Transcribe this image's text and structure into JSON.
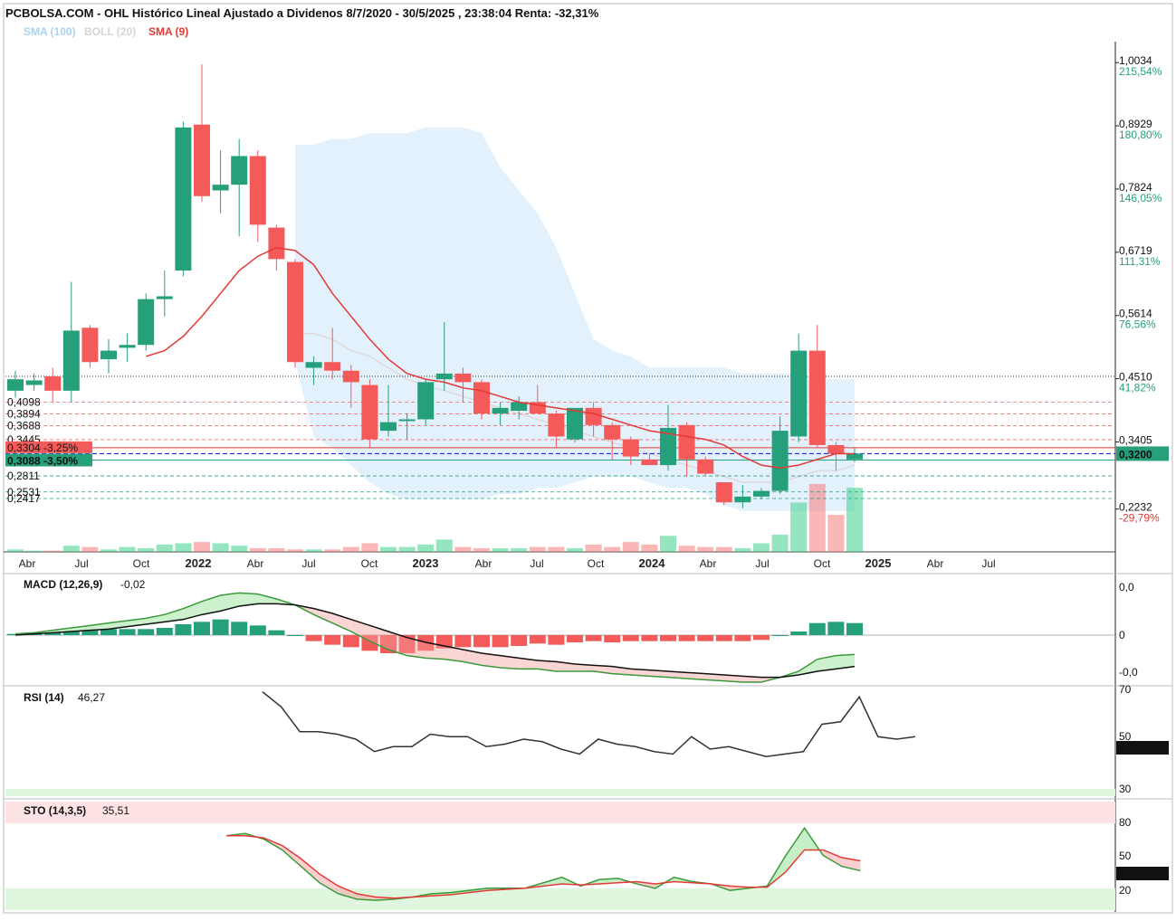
{
  "header": {
    "title": "PCBOLSA.COM - OHL Histórico Lineal Ajustado a Dividenos 8/7/2020 - 30/5/2025 , 23:38:04 Renta: -32,31%",
    "legend": [
      {
        "label": "SMA (100)",
        "color": "#a9d4f0"
      },
      {
        "label": "BOLL (20)",
        "color": "#d4d4d4"
      },
      {
        "label": "SMA (9)",
        "color": "#e53935"
      }
    ]
  },
  "colors": {
    "up": "#26a07a",
    "down": "#f55a5a",
    "sma9": "#e53935",
    "boll_fill": "#cfe8fa",
    "boll_mid": "#e0d8d8"
  },
  "chart_data": [
    {
      "type": "candlestick",
      "name": "price",
      "ylim": [
        0.18,
        1.04
      ],
      "x_labels": [
        "Abr",
        "Jul",
        "Oct",
        "2022",
        "Abr",
        "Jul",
        "Oct",
        "2023",
        "Abr",
        "Jul",
        "Oct",
        "2024",
        "Abr",
        "Jul",
        "Oct",
        "2025",
        "Abr",
        "Jul"
      ],
      "right_axis": [
        {
          "value": "1,0034",
          "pct": "215,54%"
        },
        {
          "value": "0,8929",
          "pct": "180,80%"
        },
        {
          "value": "0,7824",
          "pct": "146,05%"
        },
        {
          "value": "0,6719",
          "pct": "111,31%"
        },
        {
          "value": "0,5614",
          "pct": "76,56%"
        },
        {
          "value": "0,4510",
          "pct": "41,82%"
        },
        {
          "value": "0,3405",
          "pct": "7,08%"
        },
        {
          "value": "0,2232",
          "pct": "-29,79%"
        }
      ],
      "current_price": "0,3200",
      "left_levels": [
        "0,4098",
        "0,3894",
        "0,3688",
        "0,3445",
        "0,3304 -3,25%",
        "0,3088 -3,50%",
        "0,2811",
        "0,2531",
        "0,2417"
      ],
      "candles": [
        {
          "o": 0.43,
          "h": 0.465,
          "l": 0.418,
          "c": 0.45
        },
        {
          "o": 0.44,
          "h": 0.46,
          "l": 0.43,
          "c": 0.448
        },
        {
          "o": 0.455,
          "h": 0.47,
          "l": 0.41,
          "c": 0.43
        },
        {
          "o": 0.43,
          "h": 0.62,
          "l": 0.41,
          "c": 0.535
        },
        {
          "o": 0.54,
          "h": 0.545,
          "l": 0.47,
          "c": 0.48
        },
        {
          "o": 0.485,
          "h": 0.52,
          "l": 0.46,
          "c": 0.5
        },
        {
          "o": 0.505,
          "h": 0.53,
          "l": 0.48,
          "c": 0.51
        },
        {
          "o": 0.51,
          "h": 0.6,
          "l": 0.5,
          "c": 0.59
        },
        {
          "o": 0.59,
          "h": 0.64,
          "l": 0.56,
          "c": 0.595
        },
        {
          "o": 0.64,
          "h": 0.9,
          "l": 0.63,
          "c": 0.89
        },
        {
          "o": 0.895,
          "h": 1.0,
          "l": 0.76,
          "c": 0.77
        },
        {
          "o": 0.78,
          "h": 0.85,
          "l": 0.74,
          "c": 0.79
        },
        {
          "o": 0.79,
          "h": 0.87,
          "l": 0.7,
          "c": 0.84
        },
        {
          "o": 0.84,
          "h": 0.85,
          "l": 0.69,
          "c": 0.72
        },
        {
          "o": 0.715,
          "h": 0.72,
          "l": 0.64,
          "c": 0.66
        },
        {
          "o": 0.655,
          "h": 0.66,
          "l": 0.47,
          "c": 0.48
        },
        {
          "o": 0.47,
          "h": 0.49,
          "l": 0.44,
          "c": 0.48
        },
        {
          "o": 0.48,
          "h": 0.54,
          "l": 0.45,
          "c": 0.465
        },
        {
          "o": 0.465,
          "h": 0.475,
          "l": 0.4,
          "c": 0.445
        },
        {
          "o": 0.44,
          "h": 0.45,
          "l": 0.33,
          "c": 0.345
        },
        {
          "o": 0.36,
          "h": 0.44,
          "l": 0.35,
          "c": 0.375
        },
        {
          "o": 0.38,
          "h": 0.39,
          "l": 0.345,
          "c": 0.38
        },
        {
          "o": 0.38,
          "h": 0.45,
          "l": 0.37,
          "c": 0.445
        },
        {
          "o": 0.45,
          "h": 0.55,
          "l": 0.43,
          "c": 0.46
        },
        {
          "o": 0.46,
          "h": 0.47,
          "l": 0.41,
          "c": 0.445
        },
        {
          "o": 0.445,
          "h": 0.45,
          "l": 0.38,
          "c": 0.39
        },
        {
          "o": 0.39,
          "h": 0.41,
          "l": 0.37,
          "c": 0.4
        },
        {
          "o": 0.395,
          "h": 0.42,
          "l": 0.38,
          "c": 0.41
        },
        {
          "o": 0.41,
          "h": 0.44,
          "l": 0.39,
          "c": 0.39
        },
        {
          "o": 0.39,
          "h": 0.395,
          "l": 0.33,
          "c": 0.35
        },
        {
          "o": 0.345,
          "h": 0.4,
          "l": 0.34,
          "c": 0.4
        },
        {
          "o": 0.4,
          "h": 0.41,
          "l": 0.35,
          "c": 0.37
        },
        {
          "o": 0.37,
          "h": 0.375,
          "l": 0.31,
          "c": 0.345
        },
        {
          "o": 0.345,
          "h": 0.35,
          "l": 0.3,
          "c": 0.315
        },
        {
          "o": 0.31,
          "h": 0.32,
          "l": 0.3,
          "c": 0.3
        },
        {
          "o": 0.3,
          "h": 0.405,
          "l": 0.29,
          "c": 0.365
        },
        {
          "o": 0.37,
          "h": 0.375,
          "l": 0.28,
          "c": 0.31
        },
        {
          "o": 0.31,
          "h": 0.315,
          "l": 0.28,
          "c": 0.285
        },
        {
          "o": 0.27,
          "h": 0.27,
          "l": 0.23,
          "c": 0.235
        },
        {
          "o": 0.235,
          "h": 0.265,
          "l": 0.225,
          "c": 0.245
        },
        {
          "o": 0.245,
          "h": 0.26,
          "l": 0.24,
          "c": 0.255
        },
        {
          "o": 0.255,
          "h": 0.385,
          "l": 0.25,
          "c": 0.36
        },
        {
          "o": 0.35,
          "h": 0.53,
          "l": 0.34,
          "c": 0.5
        },
        {
          "o": 0.5,
          "h": 0.545,
          "l": 0.33,
          "c": 0.335
        },
        {
          "o": 0.335,
          "h": 0.34,
          "l": 0.29,
          "c": 0.32
        },
        {
          "o": 0.31,
          "h": 0.33,
          "l": 0.305,
          "c": 0.32
        }
      ],
      "sma9": [
        null,
        null,
        null,
        null,
        null,
        null,
        null,
        0.49,
        0.5,
        0.525,
        0.56,
        0.6,
        0.64,
        0.665,
        0.68,
        0.675,
        0.65,
        0.6,
        0.56,
        0.52,
        0.485,
        0.46,
        0.45,
        0.445,
        0.435,
        0.43,
        0.42,
        0.41,
        0.405,
        0.4,
        0.395,
        0.39,
        0.38,
        0.37,
        0.36,
        0.355,
        0.35,
        0.345,
        0.335,
        0.315,
        0.3,
        0.295,
        0.3,
        0.31,
        0.32,
        0.32
      ],
      "boll_upper": [
        null,
        null,
        null,
        null,
        null,
        null,
        null,
        null,
        null,
        null,
        null,
        null,
        null,
        null,
        null,
        0.86,
        0.86,
        0.87,
        0.87,
        0.88,
        0.88,
        0.88,
        0.89,
        0.89,
        0.89,
        0.88,
        0.82,
        0.78,
        0.74,
        0.68,
        0.6,
        0.52,
        0.5,
        0.49,
        0.47,
        0.47,
        0.47,
        0.47,
        0.47,
        0.46,
        0.46,
        0.46,
        0.46,
        0.45,
        0.45,
        0.45
      ],
      "boll_lower": [
        null,
        null,
        null,
        null,
        null,
        null,
        null,
        null,
        null,
        null,
        null,
        null,
        null,
        null,
        null,
        0.48,
        0.35,
        0.33,
        0.3,
        0.27,
        0.25,
        0.24,
        0.24,
        0.24,
        0.24,
        0.24,
        0.25,
        0.25,
        0.26,
        0.26,
        0.27,
        0.28,
        0.28,
        0.28,
        0.27,
        0.26,
        0.26,
        0.25,
        0.23,
        0.22,
        0.22,
        0.22,
        0.22,
        0.22,
        0.22,
        0.22
      ],
      "boll_mid": [
        null,
        null,
        null,
        null,
        null,
        null,
        null,
        null,
        null,
        null,
        null,
        null,
        null,
        null,
        null,
        0.53,
        0.53,
        0.52,
        0.5,
        0.49,
        0.47,
        0.45,
        0.44,
        0.43,
        0.42,
        0.41,
        0.4,
        0.39,
        0.38,
        0.37,
        0.36,
        0.35,
        0.34,
        0.33,
        0.32,
        0.31,
        0.3,
        0.29,
        0.28,
        0.27,
        0.27,
        0.27,
        0.28,
        0.29,
        0.29,
        0.3
      ],
      "volume": [
        2,
        1,
        1,
        5,
        4,
        2,
        4,
        3,
        6,
        7,
        8,
        7,
        5,
        3,
        3,
        2,
        2,
        2,
        4,
        7,
        4,
        4,
        6,
        10,
        4,
        3,
        3,
        3,
        4,
        4,
        3,
        6,
        4,
        8,
        6,
        13,
        5,
        4,
        4,
        3,
        7,
        14,
        40,
        55,
        30,
        52
      ]
    },
    {
      "type": "line",
      "name": "MACD",
      "label": "MACD (12,26,9)",
      "value": "-0,02",
      "right_axis": [
        "0,0",
        "0",
        "-0,0"
      ],
      "macd": [
        0.01,
        0.02,
        0.04,
        0.06,
        0.08,
        0.1,
        0.12,
        0.14,
        0.17,
        0.22,
        0.28,
        0.33,
        0.35,
        0.34,
        0.3,
        0.25,
        0.17,
        0.1,
        0.03,
        -0.05,
        -0.12,
        -0.17,
        -0.19,
        -0.2,
        -0.22,
        -0.25,
        -0.27,
        -0.28,
        -0.28,
        -0.3,
        -0.3,
        -0.3,
        -0.32,
        -0.33,
        -0.34,
        -0.35,
        -0.36,
        -0.37,
        -0.38,
        -0.39,
        -0.39,
        -0.35,
        -0.3,
        -0.2,
        -0.17,
        -0.16
      ],
      "signal": [
        0.0,
        0.01,
        0.02,
        0.03,
        0.04,
        0.05,
        0.07,
        0.09,
        0.11,
        0.13,
        0.17,
        0.2,
        0.24,
        0.26,
        0.26,
        0.25,
        0.22,
        0.18,
        0.13,
        0.08,
        0.03,
        -0.02,
        -0.06,
        -0.09,
        -0.12,
        -0.15,
        -0.17,
        -0.19,
        -0.21,
        -0.22,
        -0.24,
        -0.25,
        -0.26,
        -0.28,
        -0.29,
        -0.3,
        -0.31,
        -0.32,
        -0.33,
        -0.34,
        -0.35,
        -0.35,
        -0.33,
        -0.3,
        -0.28,
        -0.26
      ],
      "hist": [
        0.01,
        0.01,
        0.02,
        0.03,
        0.04,
        0.05,
        0.05,
        0.05,
        0.06,
        0.09,
        0.11,
        0.13,
        0.11,
        0.08,
        0.04,
        0.0,
        -0.05,
        -0.08,
        -0.1,
        -0.13,
        -0.15,
        -0.15,
        -0.13,
        -0.11,
        -0.1,
        -0.1,
        -0.1,
        -0.09,
        -0.07,
        -0.08,
        -0.06,
        -0.05,
        -0.06,
        -0.05,
        -0.05,
        -0.05,
        -0.05,
        -0.05,
        -0.05,
        -0.05,
        -0.04,
        0.0,
        0.03,
        0.1,
        0.11,
        0.1
      ]
    },
    {
      "type": "line",
      "name": "RSI",
      "label": "RSI (14)",
      "value": "46,27",
      "current": "46,276",
      "right_axis": [
        "70",
        "50",
        "30"
      ],
      "ylim": [
        30,
        70
      ],
      "values": [
        null,
        null,
        null,
        null,
        null,
        null,
        null,
        null,
        null,
        null,
        null,
        null,
        null,
        null,
        69,
        63,
        53,
        53,
        52,
        50,
        45,
        47,
        47,
        52,
        51,
        51,
        47,
        48,
        50,
        49,
        46,
        44,
        50,
        48,
        47,
        45,
        44,
        51,
        46,
        47,
        45,
        43,
        44,
        45,
        56,
        57,
        67,
        51,
        50,
        51
      ]
    },
    {
      "type": "line",
      "name": "STO",
      "label": "STO (14,3,5)",
      "value": "35,51",
      "current": "35,516",
      "right_axis": [
        "80",
        "50",
        "20"
      ],
      "ylim": [
        0,
        100
      ],
      "k": [
        null,
        null,
        null,
        null,
        null,
        null,
        null,
        null,
        null,
        null,
        null,
        null,
        68,
        70,
        65,
        55,
        40,
        25,
        15,
        10,
        9,
        10,
        12,
        15,
        16,
        18,
        20,
        20,
        20,
        25,
        30,
        22,
        28,
        29,
        24,
        20,
        30,
        26,
        24,
        18,
        20,
        22,
        50,
        75,
        50,
        40,
        36
      ],
      "d": [
        null,
        null,
        null,
        null,
        null,
        null,
        null,
        null,
        null,
        null,
        null,
        null,
        68,
        68,
        66,
        59,
        47,
        33,
        22,
        15,
        12,
        11,
        12,
        13,
        14,
        16,
        18,
        19,
        20,
        22,
        24,
        23,
        24,
        25,
        26,
        24,
        26,
        25,
        24,
        22,
        21,
        21,
        35,
        55,
        55,
        48,
        45
      ]
    }
  ]
}
